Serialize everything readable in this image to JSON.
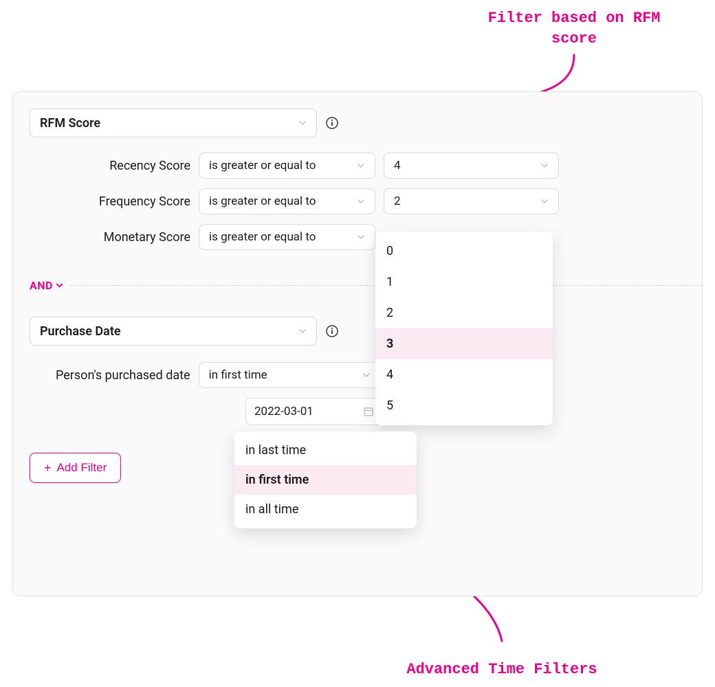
{
  "annotationTop": "Filter based on RFM score",
  "annotationBottom": "Advanced Time Filters",
  "filter1": {
    "title": "RFM Score",
    "rows": {
      "recency": {
        "label": "Recency Score",
        "op": "is greater or equal to",
        "value": "4"
      },
      "frequency": {
        "label": "Frequency Score",
        "op": "is greater or equal to",
        "value": "2"
      },
      "monetary": {
        "label": "Monetary Score",
        "op": "is greater or equal to"
      }
    }
  },
  "combiner": "AND",
  "filter2": {
    "title": "Purchase Date",
    "label": "Person's purchased date",
    "op": "in first time",
    "date": "2022-03-01"
  },
  "numMenu": {
    "options": [
      "0",
      "1",
      "2",
      "3",
      "4",
      "5"
    ],
    "highlight": "3"
  },
  "timeMenu": {
    "options": [
      "in last time",
      "in first time",
      "in all time"
    ],
    "highlight": "in first time"
  },
  "addFilter": "Add Filter"
}
